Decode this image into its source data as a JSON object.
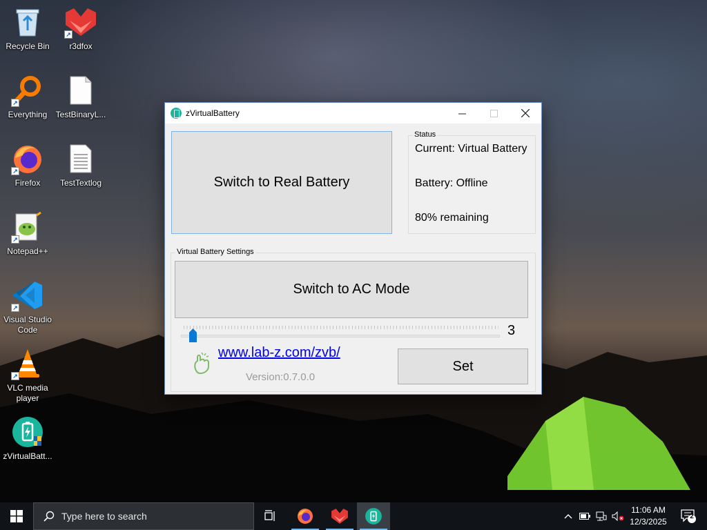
{
  "desktop": {
    "icons": [
      {
        "label": "Recycle Bin",
        "icon": "recycle-bin-icon"
      },
      {
        "label": "r3dfox",
        "icon": "r3dfox-icon"
      },
      {
        "label": "Everything",
        "icon": "everything-search-icon"
      },
      {
        "label": "TestBinaryL...",
        "icon": "file-icon"
      },
      {
        "label": "Firefox",
        "icon": "firefox-icon"
      },
      {
        "label": "TestTextlog",
        "icon": "text-file-icon"
      },
      {
        "label": "Notepad++",
        "icon": "notepad-plus-plus-icon"
      },
      {
        "label": "Visual Studio Code",
        "icon": "vscode-icon"
      },
      {
        "label": "VLC media player",
        "icon": "vlc-icon"
      },
      {
        "label": "zVirtualBatt...",
        "icon": "zvirtualbattery-icon"
      }
    ]
  },
  "window": {
    "title": "zVirtualBattery",
    "switch_battery_label": "Switch to Real Battery",
    "status": {
      "legend": "Status",
      "current": "Current: Virtual Battery",
      "battery": "Battery: Offline",
      "remaining": "80% remaining"
    },
    "settings": {
      "legend": "Virtual Battery Settings",
      "switch_ac_label": "Switch to AC Mode",
      "slider_value": "3",
      "link": "www.lab-z.com/zvb/",
      "version": "Version:0.7.0.0",
      "set_label": "Set"
    }
  },
  "taskbar": {
    "search_placeholder": "Type here to search",
    "time": "11:06 AM",
    "date": "12/3/2025",
    "notification_count": "2"
  },
  "colors": {
    "accent": "#0a78d7",
    "app_teal": "#19b59d",
    "link": "#0000ee"
  }
}
